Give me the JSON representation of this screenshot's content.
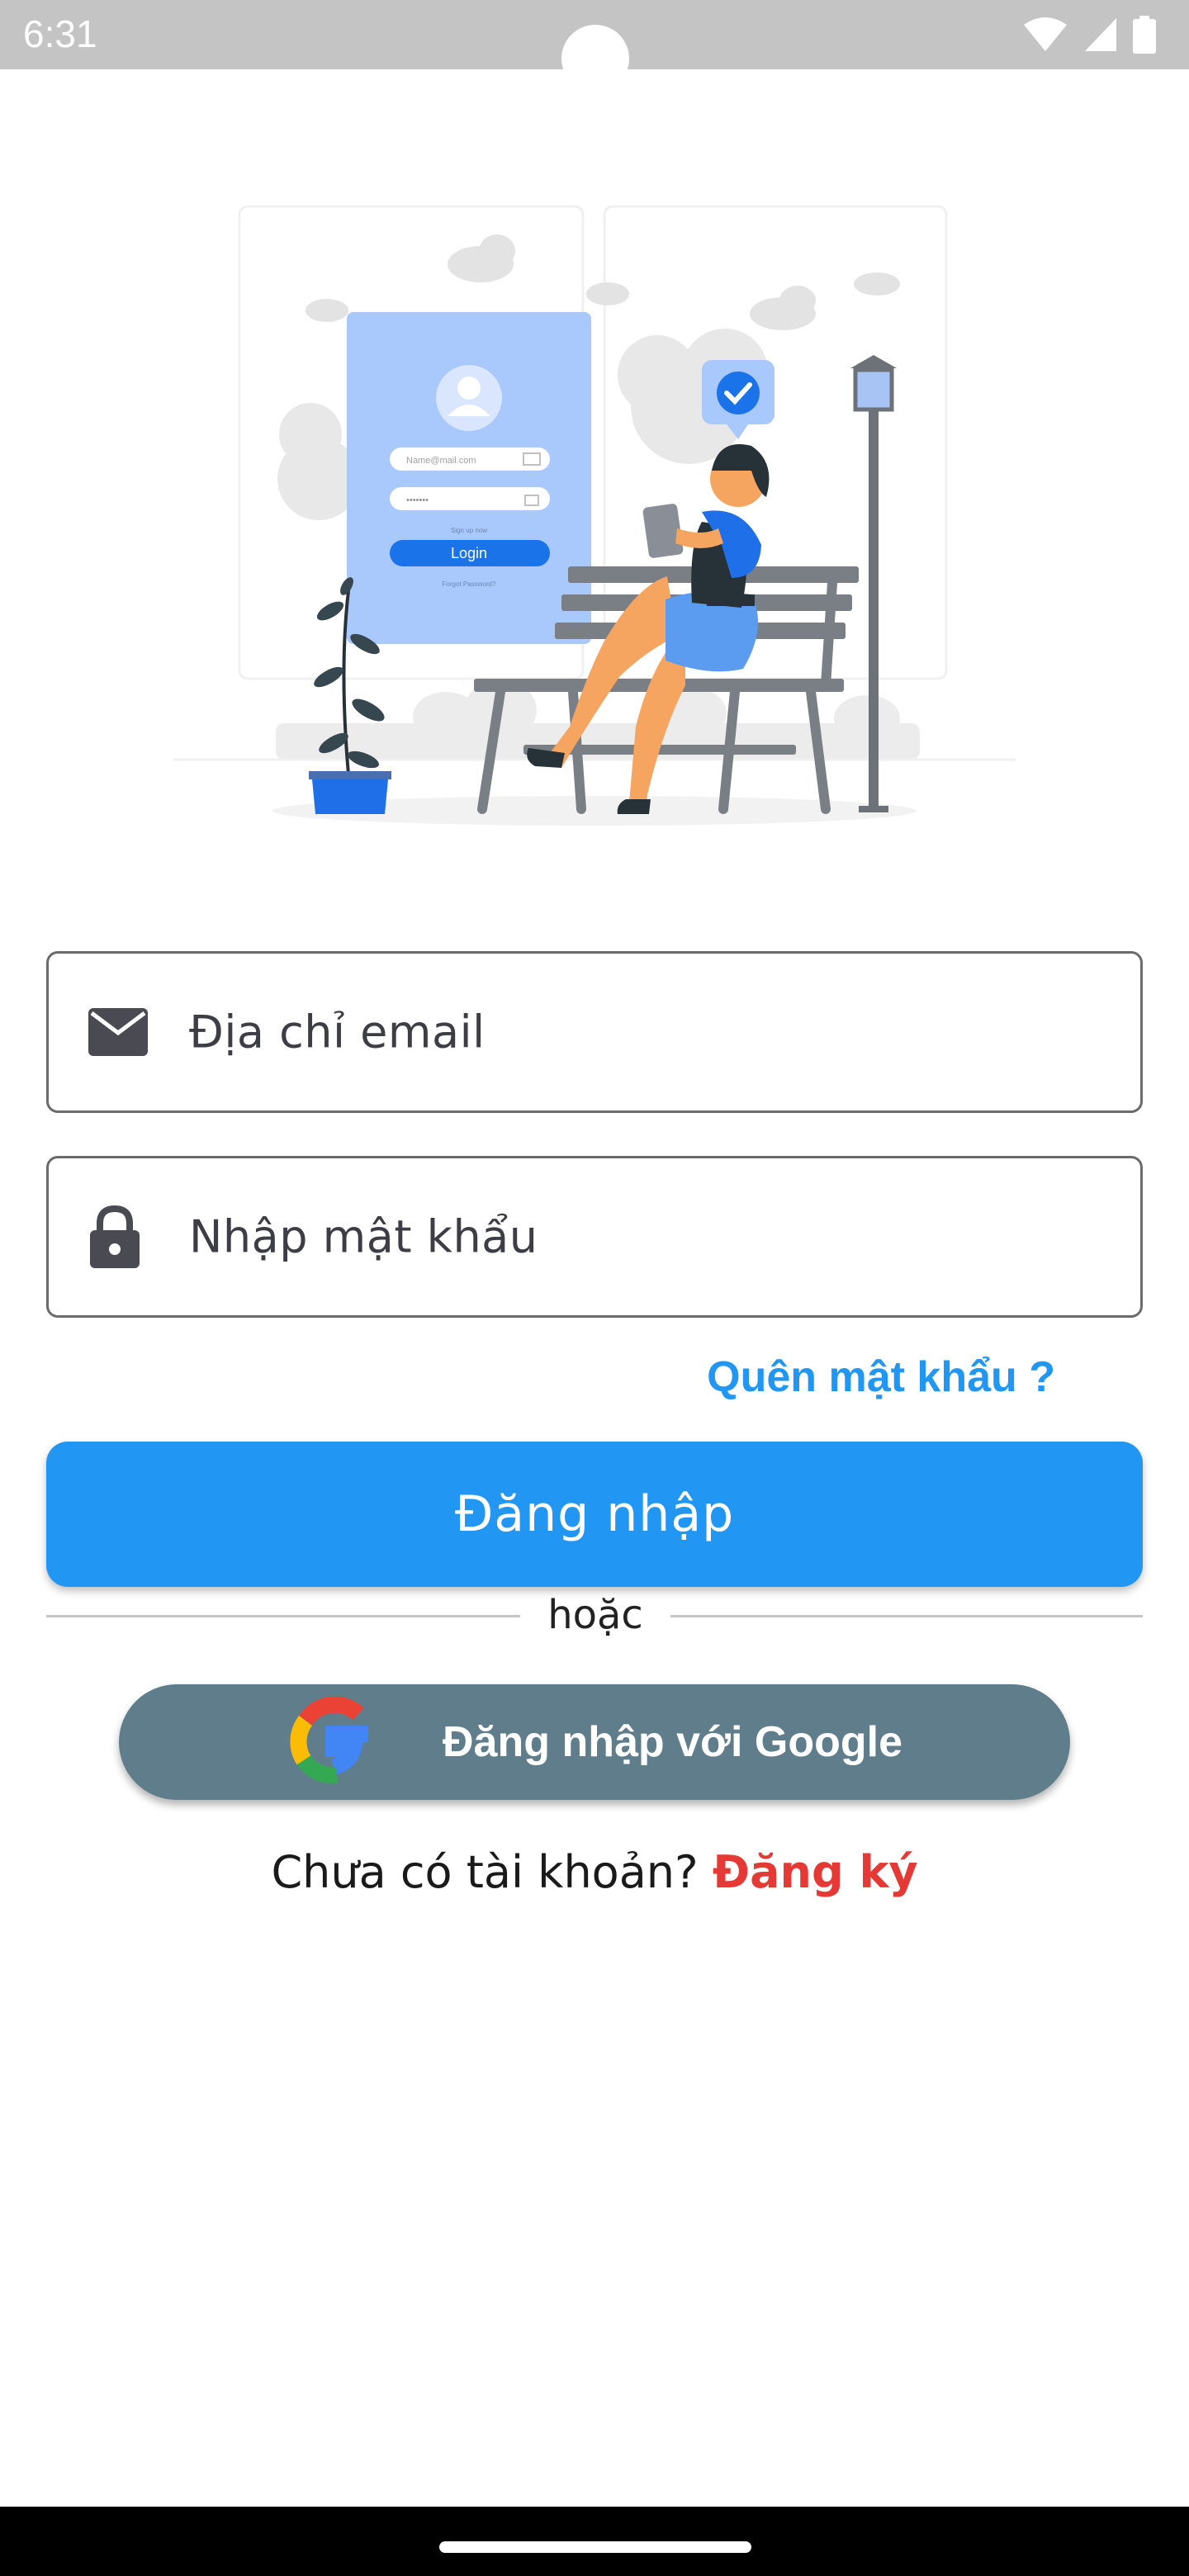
{
  "status_bar": {
    "time": "6:31"
  },
  "illustration": {
    "form_email_placeholder": "Name@mail.com",
    "form_password": "•••••••",
    "form_signup": "Sign up now",
    "form_login": "Login",
    "form_forgot": "Forgot Password?"
  },
  "form": {
    "email_placeholder": "Địa chỉ email",
    "password_placeholder": "Nhập mật khẩu",
    "forgot_password": "Quên mật khẩu ?",
    "login_button": "Đăng nhập",
    "divider": "hoặc",
    "google_button": "Đăng nhập với Google",
    "no_account": "Chưa có tài khoản?",
    "signup_link": "Đăng ký"
  },
  "colors": {
    "primary": "#2196f3",
    "google_button": "#607d8b",
    "signup": "#e53935"
  },
  "icons": [
    "wifi-icon",
    "signal-icon",
    "battery-icon",
    "mail-icon",
    "lock-icon",
    "google-logo-icon"
  ]
}
